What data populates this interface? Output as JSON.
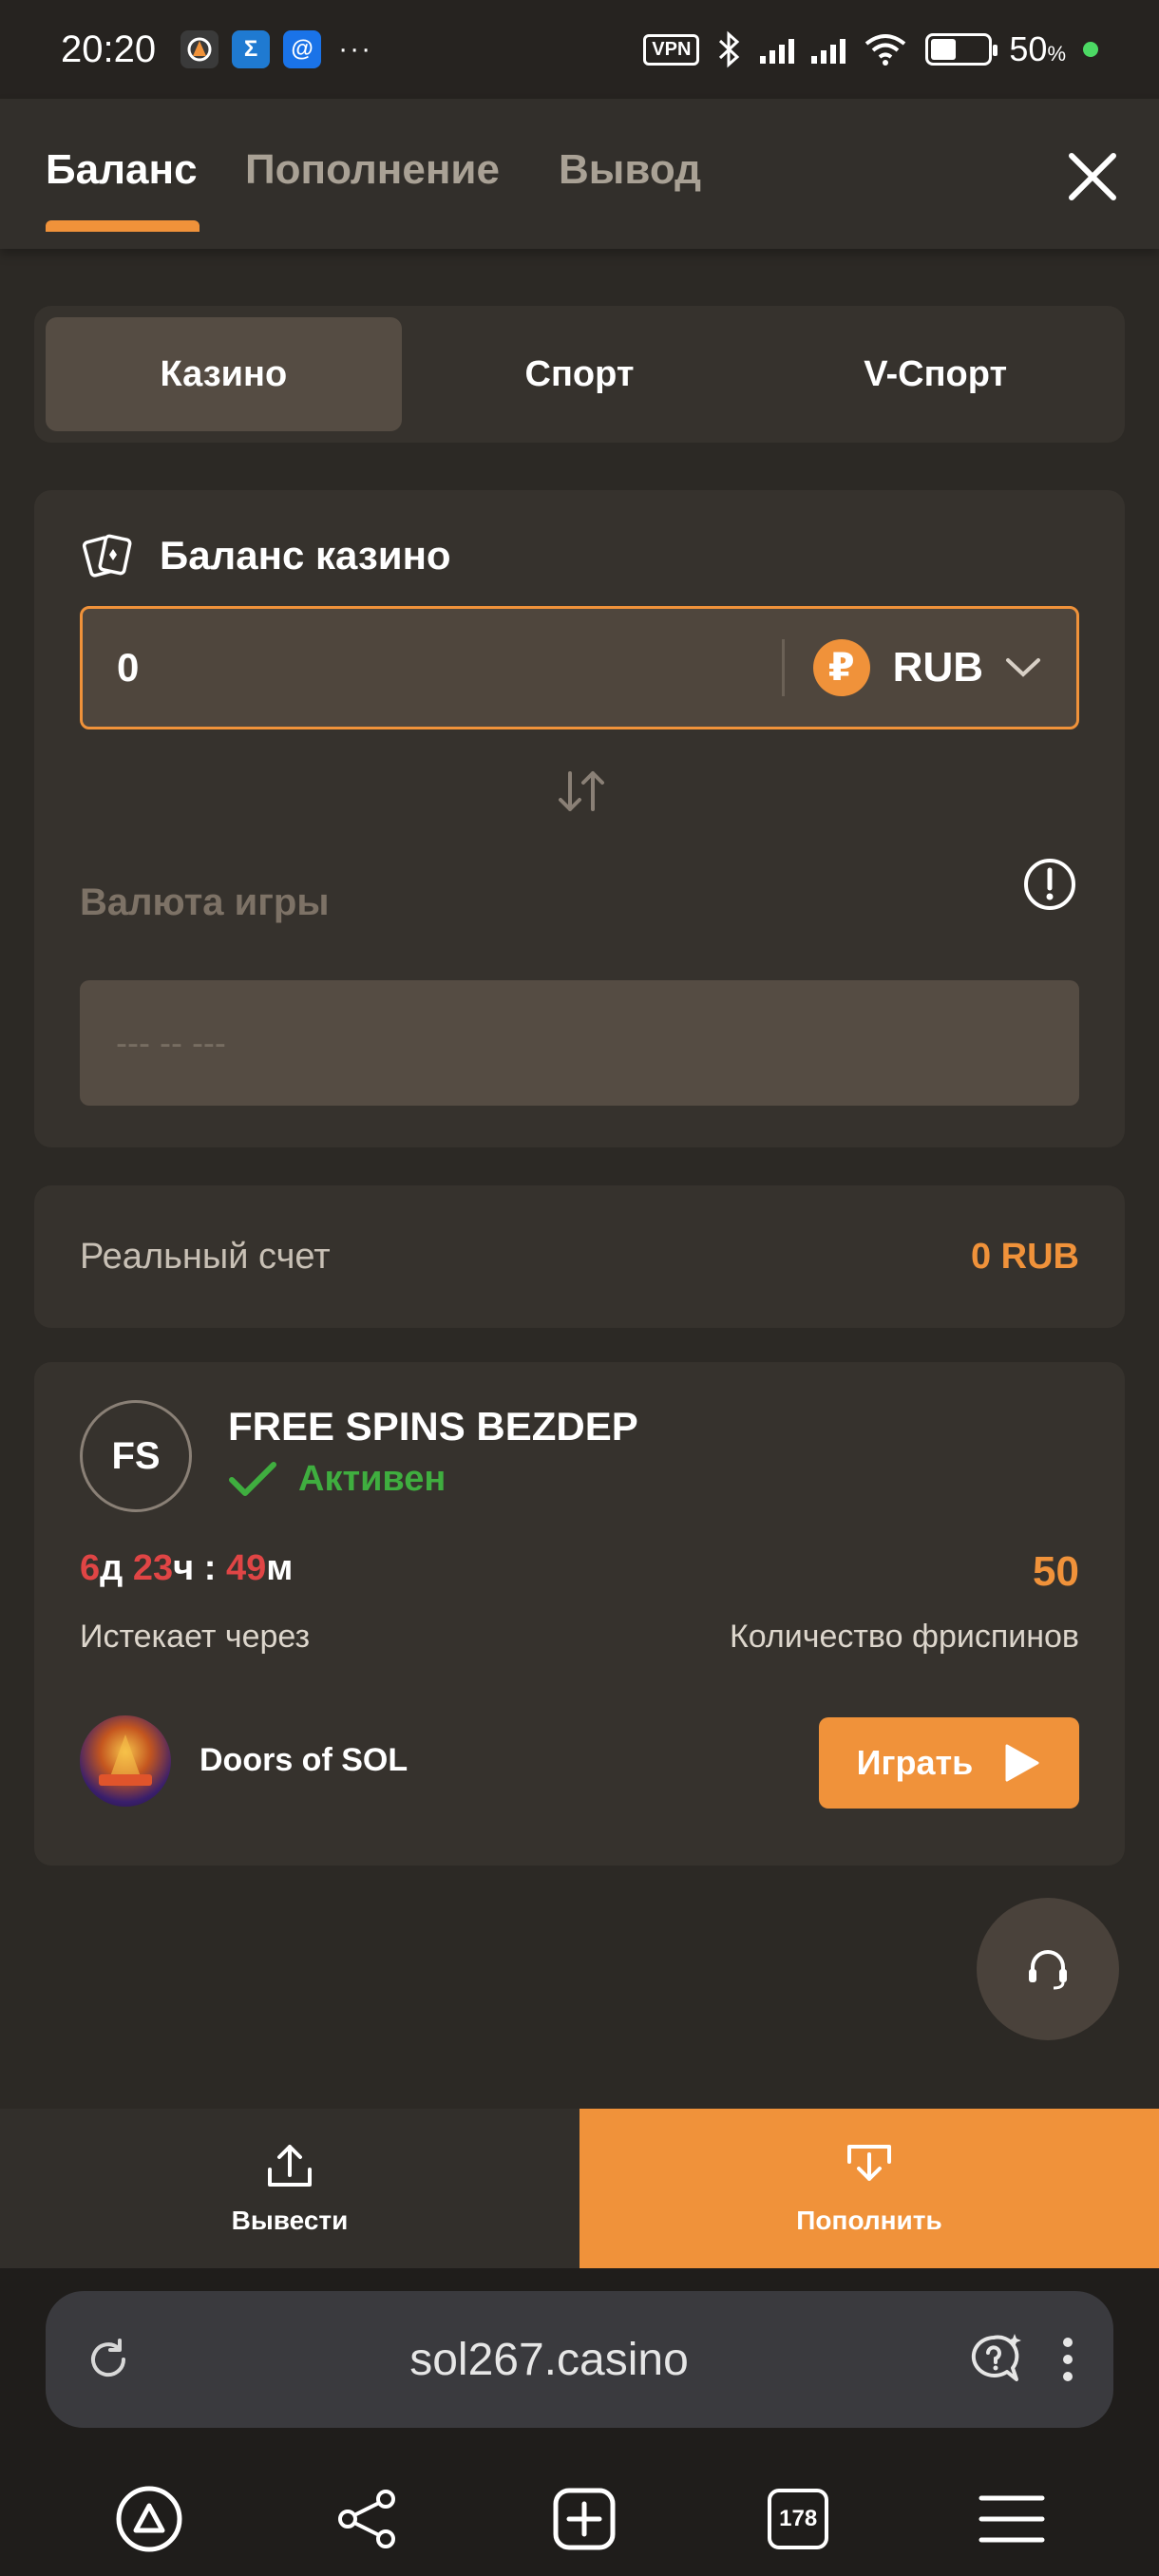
{
  "status_bar": {
    "time": "20:20",
    "more": "···",
    "vpn": "VPN",
    "battery_percent": "50",
    "battery_unit": "%"
  },
  "header": {
    "tabs": [
      {
        "label": "Баланс",
        "active": true
      },
      {
        "label": "Пополнение",
        "active": false
      },
      {
        "label": "Вывод",
        "active": false
      }
    ]
  },
  "segments": [
    {
      "label": "Казино",
      "active": true
    },
    {
      "label": "Спорт",
      "active": false
    },
    {
      "label": "V-Спорт",
      "active": false
    }
  ],
  "balance_card": {
    "title": "Баланс казино",
    "amount": "0",
    "currency_symbol": "₽",
    "currency": "RUB",
    "game_currency_label": "Валюта игры",
    "game_currency_placeholder": "--- -- ---"
  },
  "real_account": {
    "label": "Реальный счет",
    "value": "0 RUB"
  },
  "bonus": {
    "avatar_text": "FS",
    "title": "FREE SPINS BEZDEP",
    "status": "Активен",
    "timer": {
      "d": "6",
      "d_unit": "д",
      "h": "23",
      "h_unit": "ч",
      "sep": " : ",
      "m": "49",
      "m_unit": "м"
    },
    "count": "50",
    "expires_label": "Истекает через",
    "count_label": "Количество фриспинов",
    "game_name": "Doors of SOL",
    "play_label": "Играть"
  },
  "actions": {
    "withdraw": "Вывести",
    "deposit": "Пополнить"
  },
  "browser": {
    "url": "sol267.casino",
    "tabs_count": "178"
  },
  "colors": {
    "accent": "#f0923a",
    "active_green": "#3fae3f",
    "timer_red": "#e04545",
    "background": "#2c2925"
  }
}
